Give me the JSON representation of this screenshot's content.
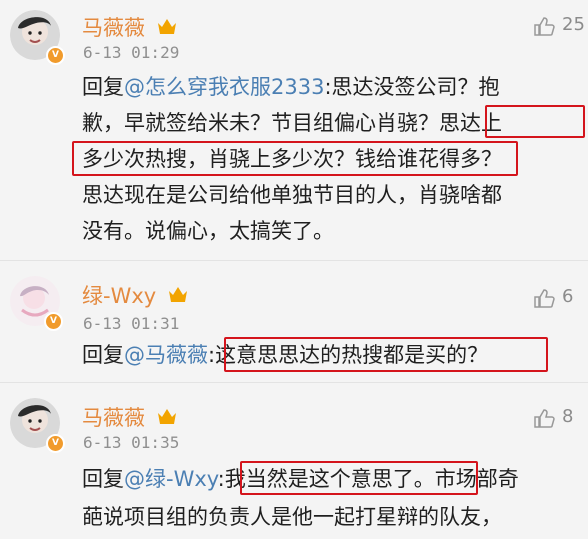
{
  "comments": [
    {
      "username": "马薇薇",
      "time": "6-13 01:29",
      "likes": "25",
      "lines": [
        {
          "prefix": "回复",
          "mention": "@怎么穿我衣服2333",
          "text": ":思达没签公司？抱"
        },
        {
          "text": "歉，早就签给米未？节目组偏心肖骁？",
          "highlight": "思达上"
        },
        {
          "highlight": "多少次热搜，肖骁上多少次？钱给谁花得多？"
        },
        {
          "text": "思达现在是公司给他单独节目的人，肖骁啥都"
        },
        {
          "text": "没有。说偏心，太搞笑了。"
        }
      ]
    },
    {
      "username": "绿-Wxy",
      "time": "6-13 01:31",
      "likes": "6",
      "lines": [
        {
          "prefix": "回复",
          "mention": "@马薇薇",
          "highlight": ":这意思思达的热搜都是买的？"
        }
      ]
    },
    {
      "username": "马薇薇",
      "time": "6-13 01:35",
      "likes": "8",
      "lines": [
        {
          "prefix": "回复",
          "mention": "@绿-Wxy",
          "highlight": ":我当然是这个意思了。",
          "text": "市场部奇"
        },
        {
          "text": "葩说项目组的负责人是他一起打星辩的队友，"
        }
      ]
    }
  ]
}
